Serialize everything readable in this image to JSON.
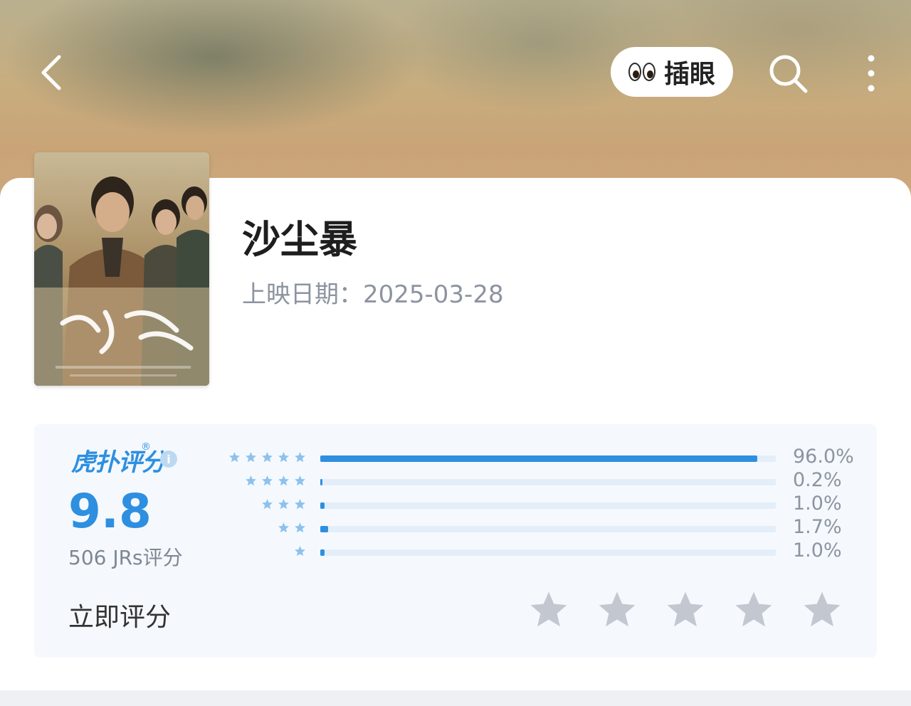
{
  "header": {
    "peek_label": "插眼",
    "icons": {
      "back": "chevron-left-icon",
      "search": "search-icon",
      "more": "more-vertical-icon"
    }
  },
  "show": {
    "title": "沙尘暴",
    "release_label": "上映日期：",
    "release_date": "2025-03-28"
  },
  "rating": {
    "brand": "虎扑评分",
    "brand_mark": "®",
    "score": "9.8",
    "count_text": "506 JRs评分",
    "distribution": [
      {
        "stars": 5,
        "percent": 96.0,
        "label": "96.0%"
      },
      {
        "stars": 4,
        "percent": 0.2,
        "label": "0.2%"
      },
      {
        "stars": 3,
        "percent": 1.0,
        "label": "1.0%"
      },
      {
        "stars": 2,
        "percent": 1.7,
        "label": "1.7%"
      },
      {
        "stars": 1,
        "percent": 1.0,
        "label": "1.0%"
      }
    ],
    "rate_now_label": "立即评分",
    "user_rating": 0,
    "colors": {
      "accent": "#2e8fe0",
      "star_empty": "#c3c7d0",
      "star_small": "#8ec2ee"
    }
  }
}
